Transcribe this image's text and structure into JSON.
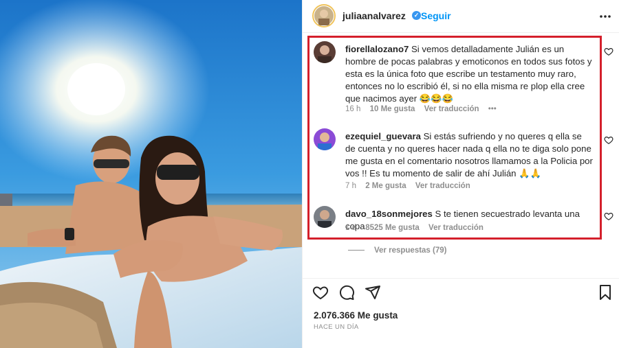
{
  "post": {
    "username": "juliaanalvarez",
    "follow_label": "Seguir",
    "likes_label": "2.076.366 Me gusta",
    "time_ago": "HACE UN DÍA"
  },
  "comments": [
    {
      "username": "fiorellalozano7",
      "text": "Si vemos detalladamente Julián es un hombre de pocas palabras y emoticonos en todos sus fotos y esta es la única foto que escribe un testamento muy raro, entonces no lo escribió él, si no ella misma re plop ella cree que nacimos ayer 😂😂😂",
      "time": "16 h",
      "likes": "10 Me gusta",
      "translate": "Ver traducción",
      "more": "•••"
    },
    {
      "username": "ezequiel_guevara",
      "text": "Si estás sufriendo y no queres q ella se de cuenta y no queres hacer nada q ella no te diga solo pone me gusta en el comentario nosotros llamamos a la Policia por vos !! Es tu momento de salir de ahí Julián 🙏🙏",
      "time": "7 h",
      "likes": "2 Me gusta",
      "translate": "Ver traducción"
    },
    {
      "username": "davo_18sonmejores",
      "text": "S te tienen secuestrado levanta una copa.",
      "time": "1 d",
      "likes": "8525 Me gusta",
      "translate": "Ver traducción"
    }
  ],
  "view_replies": "Ver respuestas (79)",
  "colors": {
    "accent_blue": "#0095f6",
    "highlight_red": "#d41f2b",
    "verified_blue": "#3897f0",
    "muted_gray": "#8e8e8e"
  },
  "icons": [
    "verified-badge-icon",
    "more-options-icon",
    "heart-icon",
    "comment-icon",
    "share-icon",
    "bookmark-icon"
  ]
}
